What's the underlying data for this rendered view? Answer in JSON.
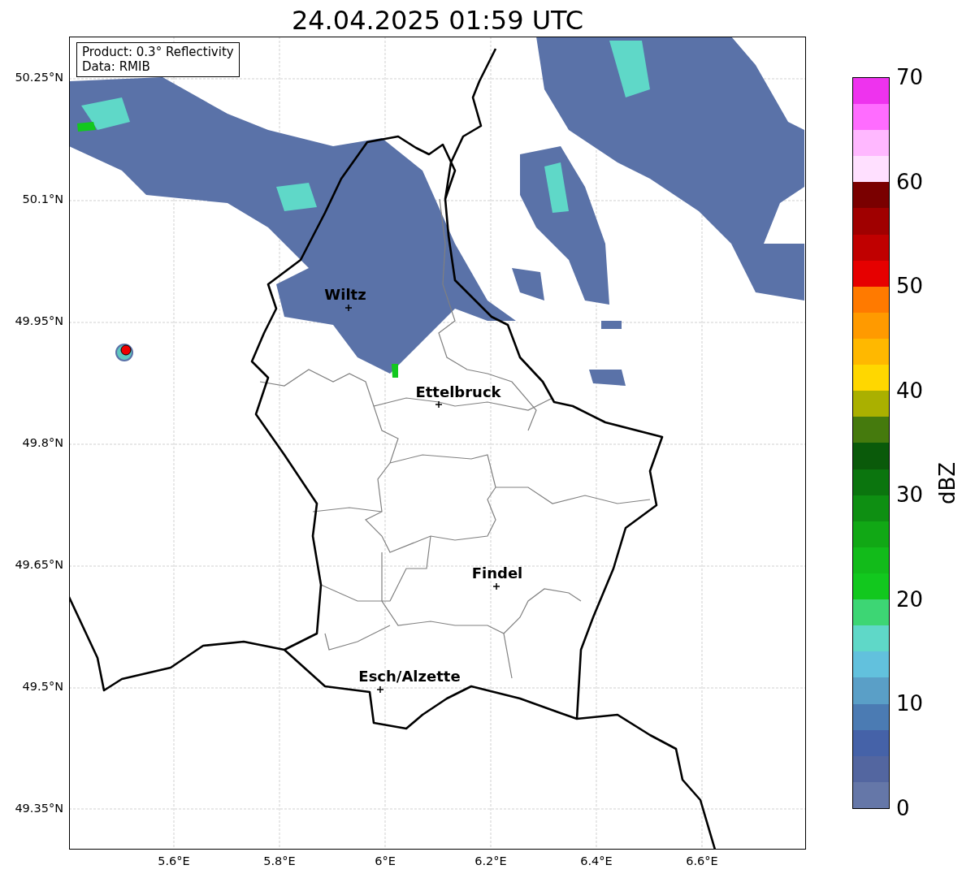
{
  "title": "24.04.2025 01:59 UTC",
  "info_box": {
    "lines": [
      "Product: 0.3° Reflectivity",
      "Data: RMIB"
    ]
  },
  "map": {
    "lat_ticks": [
      "50.25°N",
      "50.1°N",
      "49.95°N",
      "49.8°N",
      "49.65°N",
      "49.5°N",
      "49.35°N"
    ],
    "lon_ticks": [
      "5.6°E",
      "5.8°E",
      "6°E",
      "6.2°E",
      "6.4°E",
      "6.6°E"
    ],
    "cities": [
      {
        "name": "Wiltz"
      },
      {
        "name": "Ettelbruck"
      },
      {
        "name": "Findel"
      },
      {
        "name": "Esch/Alzette"
      }
    ]
  },
  "colorbar": {
    "label": "dBZ",
    "ticks": [
      "70",
      "60",
      "50",
      "40",
      "30",
      "20",
      "10",
      "0"
    ],
    "bins": [
      {
        "color": "#6577a8"
      },
      {
        "color": "#5366a0"
      },
      {
        "color": "#4562a8"
      },
      {
        "color": "#4b7bb3"
      },
      {
        "color": "#5a9fc7"
      },
      {
        "color": "#62c1dd"
      },
      {
        "color": "#5fd8c8"
      },
      {
        "color": "#3dd674"
      },
      {
        "color": "#12c81e"
      },
      {
        "color": "#12bb1a"
      },
      {
        "color": "#11a815"
      },
      {
        "color": "#0e8f12"
      },
      {
        "color": "#0b750e"
      },
      {
        "color": "#0a5a0a"
      },
      {
        "color": "#457a0d"
      },
      {
        "color": "#aab000"
      },
      {
        "color": "#ffd700"
      },
      {
        "color": "#ffb800"
      },
      {
        "color": "#ff9a00"
      },
      {
        "color": "#ff7a00"
      },
      {
        "color": "#e60000"
      },
      {
        "color": "#c00000"
      },
      {
        "color": "#a00000"
      },
      {
        "color": "#7a0000"
      },
      {
        "color": "#ffe0ff"
      },
      {
        "color": "#ffb8ff"
      },
      {
        "color": "#ff6cff"
      },
      {
        "color": "#ee33ee"
      }
    ]
  }
}
